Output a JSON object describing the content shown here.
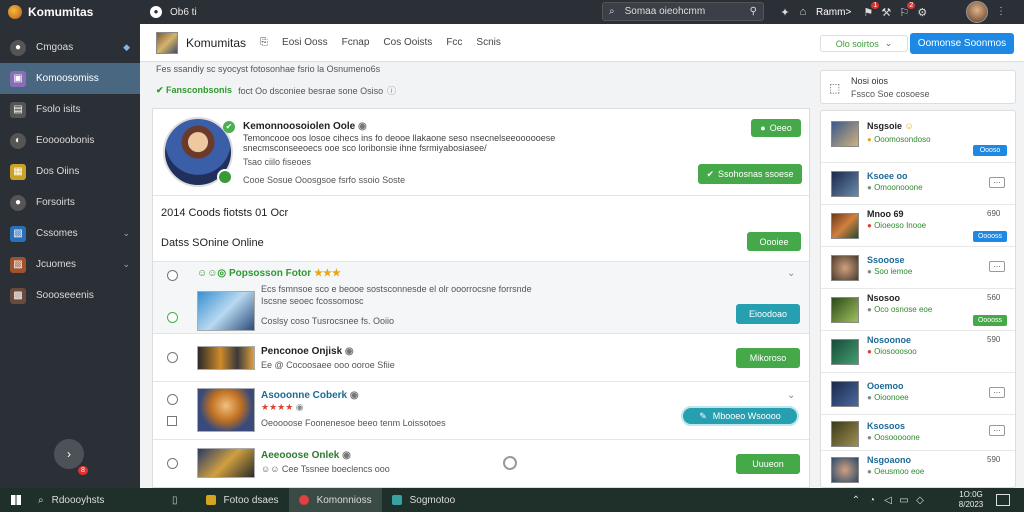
{
  "topbar": {
    "app_name": "Komumitas",
    "tab_label": "Ob6 ti",
    "search_placeholder": "Somaa oieohcmm",
    "user_name": "Ramm>",
    "notif_badge_1": "1",
    "notif_badge_2": "2"
  },
  "sidebar": {
    "items": [
      {
        "label": "Cmgoas",
        "icon": "groups-icon",
        "color": "#555"
      },
      {
        "label": "Komoosomiss",
        "icon": "community-icon",
        "color": "#8a6cb8"
      },
      {
        "label": "Fsolo isits",
        "icon": "people-icon",
        "color": "#555"
      },
      {
        "label": "Eooooobonis",
        "icon": "globe-icon",
        "color": "#555"
      },
      {
        "label": "Dos Oiins",
        "icon": "games-icon",
        "color": "#c9a227"
      },
      {
        "label": "Forsoirts",
        "icon": "friends-icon",
        "color": "#555"
      },
      {
        "label": "Cssomes",
        "icon": "apps-icon",
        "color": "#2a6fb8"
      },
      {
        "label": "Jcuomes",
        "icon": "media-icon",
        "color": "#a0522d"
      },
      {
        "label": "Soooseeenis",
        "icon": "settings-icon",
        "color": "#6a4a3a"
      }
    ],
    "fab_badge": "8"
  },
  "header": {
    "title": "Komumitas",
    "tabs": [
      "Eosi Ooss",
      "Fcnap",
      "Cos Ooists",
      "Fcc",
      "Scnis"
    ],
    "filter_label": "Olo soirtos",
    "cta_label": "Oomonse Soonmos"
  },
  "main": {
    "info_line": "Fes ssandiy sc syocyst fotosonhae fsrio la Osnumeno6s",
    "info_green": "Fansconbsonis",
    "info_rest": "foct Oo dsconiee besrae sone Osiso",
    "profile": {
      "name": "Kemonnoosoiolen Oole",
      "desc1": "Temoncooe oos losoe cihecs ins fo deooe llakaone seso nsecnelseeoooooese",
      "desc2": "snecmsconseeoecs ooe sco loribonsie ihne fsrmiyabosiasee/",
      "meta": "Tsao ciilo fiseoes",
      "meta2": "Cooe Sosue Ooosgsoe fsrfo ssoio Soste",
      "btn_small": "Oeeo",
      "btn_main": "Ssohosnas ssoese"
    },
    "stats": "2014 Coods fiotsts 01 Ocr",
    "online": "Datss SOnine Online",
    "online_btn": "Oooiee",
    "rows": [
      {
        "title": "Popsosson Fotor",
        "sub": "Ecs fsmnsoe sco e beooe sostsconnesde el olr ooorrocsne forrsnde",
        "sub2": "Iscsne seoec fcossomosc",
        "meta": "Coslsy coso  Tusrocsnee fs.  Ooiio",
        "btn": "Eioodoao",
        "stars": "★★★"
      },
      {
        "title": "Penconoe Onjisk",
        "sub": "Ee @ Cocoosaee ooo ooroe Sfiie",
        "btn": "Mikoroso"
      },
      {
        "title": "Asooonne Coberk",
        "sub": "Oeoooose Foonenesoe beeo tenm Loissotoes",
        "stars": "★★★★",
        "btn": "Mbooeo Wsoooo"
      },
      {
        "title": "Aeeooose Onlek",
        "sub": "Cee Tssnee boeclencs ooo",
        "btn": "Uuueon"
      }
    ]
  },
  "rightpanel": {
    "notice_title": "Nosi oios",
    "notice_sub": "Fssco Soe cosoese",
    "items": [
      {
        "name": "Nsgsoie",
        "sub": "Ooomosondoso",
        "btn": "Oooso",
        "btype": "blue"
      },
      {
        "name": "Ksoee oo",
        "sub": "Omoonooone",
        "btn": "",
        "btype": "outline"
      },
      {
        "name": "Mnoo 69",
        "sub": "Oioeoso Inooe",
        "num": "690",
        "btn": "Ooooss",
        "btype": "blue"
      },
      {
        "name": "Ssooose",
        "sub": "Soo iemoe",
        "btn": "",
        "btype": "outline"
      },
      {
        "name": "Nsosoo",
        "sub": "Oco osnose eoe",
        "num": "560",
        "btn": "Ooooss",
        "btype": "green"
      },
      {
        "name": "Nosoonoe",
        "sub": "Oiosooosoo",
        "num": "590",
        "btn": "",
        "btype": "none"
      },
      {
        "name": "Ooemoo",
        "sub": "Oioonoee",
        "btn": "",
        "btype": "outline"
      },
      {
        "name": "Ksosoos",
        "sub": "Oosooooone",
        "btn": "",
        "btype": "outline"
      },
      {
        "name": "Nsgoaono",
        "sub": "Oeusmoo eoe",
        "num": "590",
        "btn": "",
        "btype": "none"
      }
    ]
  },
  "taskbar": {
    "search_text": "Rdoooyhsts",
    "apps": [
      "Fotoo dsaes",
      "Komonnioss",
      "Sogmotoo"
    ],
    "clock_time": "1O:0G",
    "clock_date": "8/2023"
  }
}
